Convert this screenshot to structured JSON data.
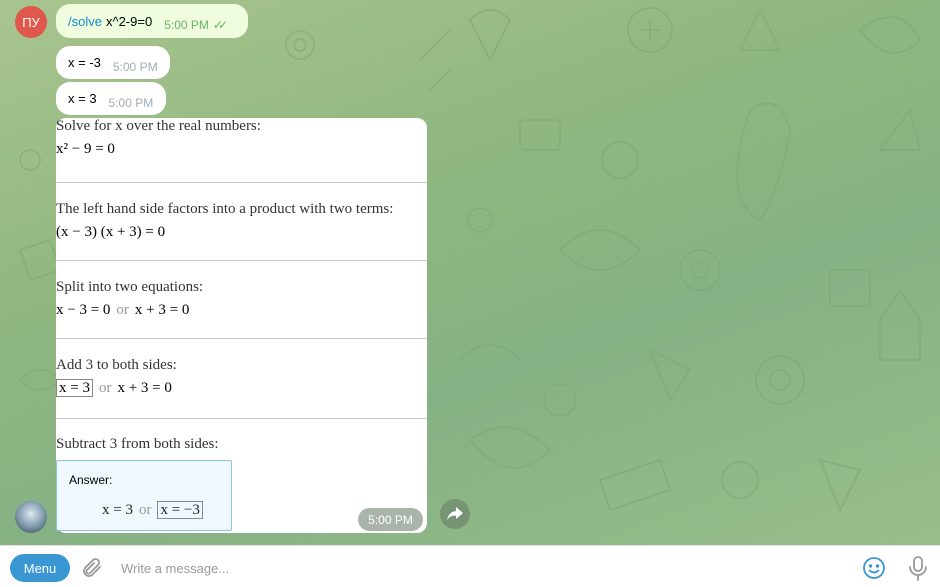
{
  "user": {
    "initials": "ПУ",
    "avatar_color": "#e0574c"
  },
  "messages": [
    {
      "command": "/solve",
      "text": "x^2-9=0",
      "time": "5:00 PM",
      "direction": "outgoing",
      "status": "read"
    },
    {
      "text": "x = -3",
      "time": "5:00 PM",
      "direction": "incoming"
    },
    {
      "text": "x = 3",
      "time": "5:00 PM",
      "direction": "incoming"
    }
  ],
  "solution": {
    "steps": [
      {
        "title": "Solve for x over the real numbers:",
        "math": "x² − 9 = 0"
      },
      {
        "title": "The left hand side factors into a product with two terms:",
        "math": "(x − 3) (x + 3) = 0"
      },
      {
        "title": "Split into two equations:",
        "math_left": "x − 3 = 0",
        "or": "or",
        "math_right": "x + 3 = 0"
      },
      {
        "title": "Add 3 to both sides:",
        "math_left": "x = 3",
        "or": "or",
        "math_right": "x + 3 = 0"
      },
      {
        "title": "Subtract 3 from both sides:"
      }
    ],
    "answer": {
      "label": "Answer:",
      "left": "x = 3",
      "or": "or",
      "right": "x = −3"
    },
    "time": "5:00 PM"
  },
  "composer": {
    "menu_label": "Menu",
    "placeholder": "Write a message..."
  },
  "colors": {
    "accent": "#3a97d4",
    "outgoing_bubble": "#effdde",
    "read_check": "#6cb267"
  },
  "icons": [
    "share-icon",
    "attach-icon",
    "emoji-icon",
    "microphone-icon",
    "read-checks-icon"
  ]
}
